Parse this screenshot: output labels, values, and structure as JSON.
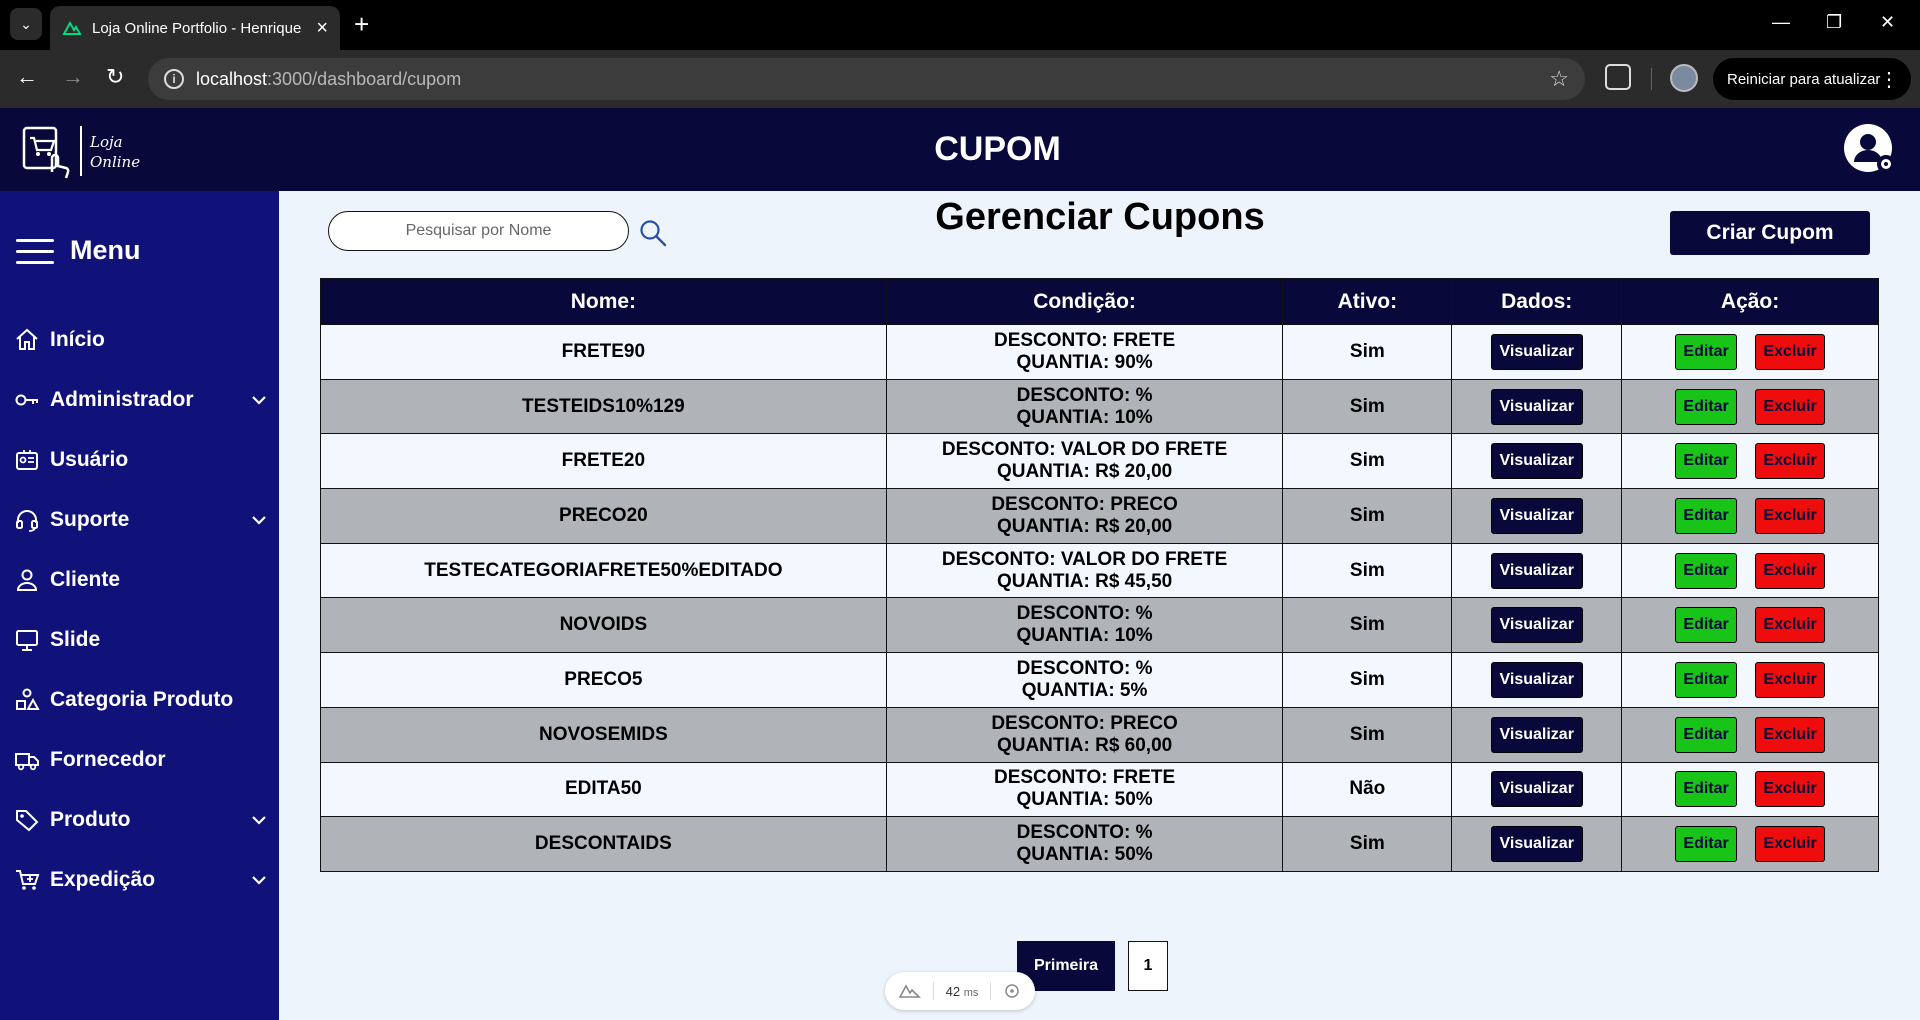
{
  "browser": {
    "tab_title": "Loja Online Portfolio - Henrique",
    "url_host": "localhost",
    "url_path": ":3000/dashboard/cupom",
    "restart_label": "Reiniciar para atualizar"
  },
  "header": {
    "logo_line1": "Loja",
    "logo_line2": "Online",
    "title": "CUPOM"
  },
  "sidebar": {
    "menu_title": "Menu",
    "items": [
      {
        "label": "Início",
        "icon": "home-icon",
        "has_submenu": false
      },
      {
        "label": "Administrador",
        "icon": "key-icon",
        "has_submenu": true
      },
      {
        "label": "Usuário",
        "icon": "id-card-icon",
        "has_submenu": false
      },
      {
        "label": "Suporte",
        "icon": "headset-icon",
        "has_submenu": true
      },
      {
        "label": "Cliente",
        "icon": "person-icon",
        "has_submenu": false
      },
      {
        "label": "Slide",
        "icon": "monitor-icon",
        "has_submenu": false
      },
      {
        "label": "Categoria Produto",
        "icon": "shapes-icon",
        "has_submenu": false
      },
      {
        "label": "Fornecedor",
        "icon": "truck-icon",
        "has_submenu": false
      },
      {
        "label": "Produto",
        "icon": "tag-icon",
        "has_submenu": true
      },
      {
        "label": "Expedição",
        "icon": "cart-icon",
        "has_submenu": true
      }
    ]
  },
  "main": {
    "search_placeholder": "Pesquisar por Nome",
    "title": "Gerenciar Cupons",
    "create_button": "Criar Cupom",
    "columns": [
      "Nome:",
      "Condição:",
      "Ativo:",
      "Dados:",
      "Ação:"
    ],
    "view_label": "Visualizar",
    "edit_label": "Editar",
    "delete_label": "Excluir",
    "rows": [
      {
        "name": "FRETE90",
        "discount": "DESCONTO: FRETE",
        "amount": "QUANTIA: 90%",
        "active": "Sim"
      },
      {
        "name": "TESTEIDS10%129",
        "discount": "DESCONTO: %",
        "amount": "QUANTIA: 10%",
        "active": "Sim"
      },
      {
        "name": "FRETE20",
        "discount": "DESCONTO: VALOR DO FRETE",
        "amount": "QUANTIA: R$ 20,00",
        "active": "Sim"
      },
      {
        "name": "PRECO20",
        "discount": "DESCONTO: PRECO",
        "amount": "QUANTIA: R$ 20,00",
        "active": "Sim"
      },
      {
        "name": "TESTECATEGORIAFRETE50%EDITADO",
        "discount": "DESCONTO: VALOR DO FRETE",
        "amount": "QUANTIA: R$ 45,50",
        "active": "Sim"
      },
      {
        "name": "NOVOIDS",
        "discount": "DESCONTO: %",
        "amount": "QUANTIA: 10%",
        "active": "Sim"
      },
      {
        "name": "PRECO5",
        "discount": "DESCONTO: %",
        "amount": "QUANTIA: 5%",
        "active": "Sim"
      },
      {
        "name": "NOVOSEMIDS",
        "discount": "DESCONTO: PRECO",
        "amount": "QUANTIA: R$ 60,00",
        "active": "Sim"
      },
      {
        "name": "EDITA50",
        "discount": "DESCONTO: FRETE",
        "amount": "QUANTIA: 50%",
        "active": "Não"
      },
      {
        "name": "DESCONTAIDS",
        "discount": "DESCONTO: %",
        "amount": "QUANTIA: 50%",
        "active": "Sim"
      }
    ]
  },
  "pagination": {
    "first_label": "Primeira",
    "current_page": "1"
  },
  "devtools": {
    "timing_value": "42",
    "timing_unit": "ms"
  },
  "colors": {
    "navy": "#08093a",
    "sidebar": "#10127a",
    "edit_green": "#19c419",
    "delete_red": "#ee0c0c",
    "row_gray": "#b0b4b8",
    "row_light": "#f3f8ff"
  }
}
